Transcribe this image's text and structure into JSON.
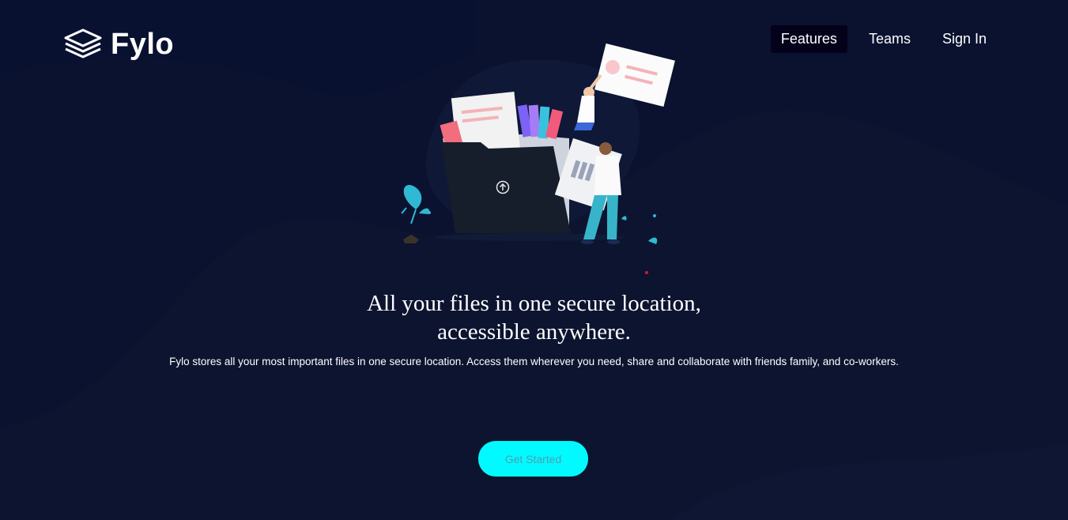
{
  "brand": {
    "name": "Fylo",
    "icon": "stacked-layers-icon"
  },
  "nav": {
    "items": [
      {
        "label": "Features",
        "active": true
      },
      {
        "label": "Teams",
        "active": false
      },
      {
        "label": "Sign In",
        "active": false
      }
    ]
  },
  "hero": {
    "headline_line1": "All your files in one secure location,",
    "headline_line2": "accessible anywhere.",
    "description": "Fylo stores all your most important files in one secure location. Access them wherever you need, share and collaborate with friends family, and co-workers.",
    "cta_label": "Get Started"
  },
  "colors": {
    "background": "#0c1430",
    "nav_active_bg": "#03021a",
    "cta_bg": "#00faff",
    "cta_text": "#4d9fb4"
  }
}
